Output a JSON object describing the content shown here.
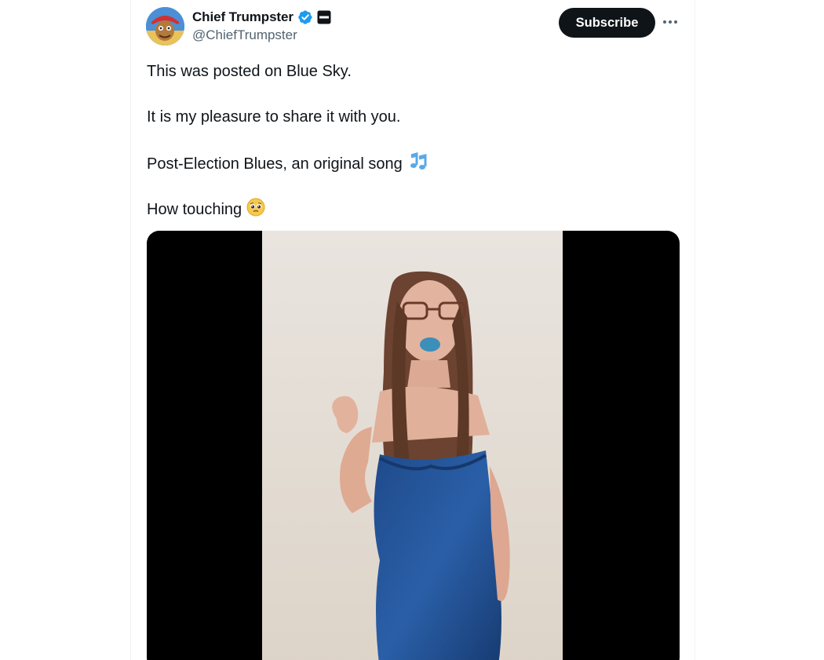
{
  "author": {
    "display_name": "Chief Trumpster",
    "handle": "@ChiefTrumpster",
    "avatar_icon": "avatar-cartoon",
    "verified_icon": "verified-badge-icon",
    "verified_color": "#1d9bf0",
    "affiliate_icon": "affiliate-badge-icon"
  },
  "actions": {
    "subscribe_label": "Subscribe",
    "more_icon": "more-dots-icon"
  },
  "tweet": {
    "lines": [
      "This was posted on Blue Sky.",
      "It is my pleasure to share it with you.",
      "Post-Election Blues, an original song",
      "How touching"
    ],
    "line3_emoji": "musical-notes-emoji",
    "line4_emoji": "pleading-face-emoji"
  },
  "media": {
    "type": "video",
    "description_icon": "video-thumbnail"
  },
  "colors": {
    "text": "#0f1419",
    "secondary_text": "#536471",
    "button_bg": "#0f1419",
    "button_text": "#ffffff"
  }
}
